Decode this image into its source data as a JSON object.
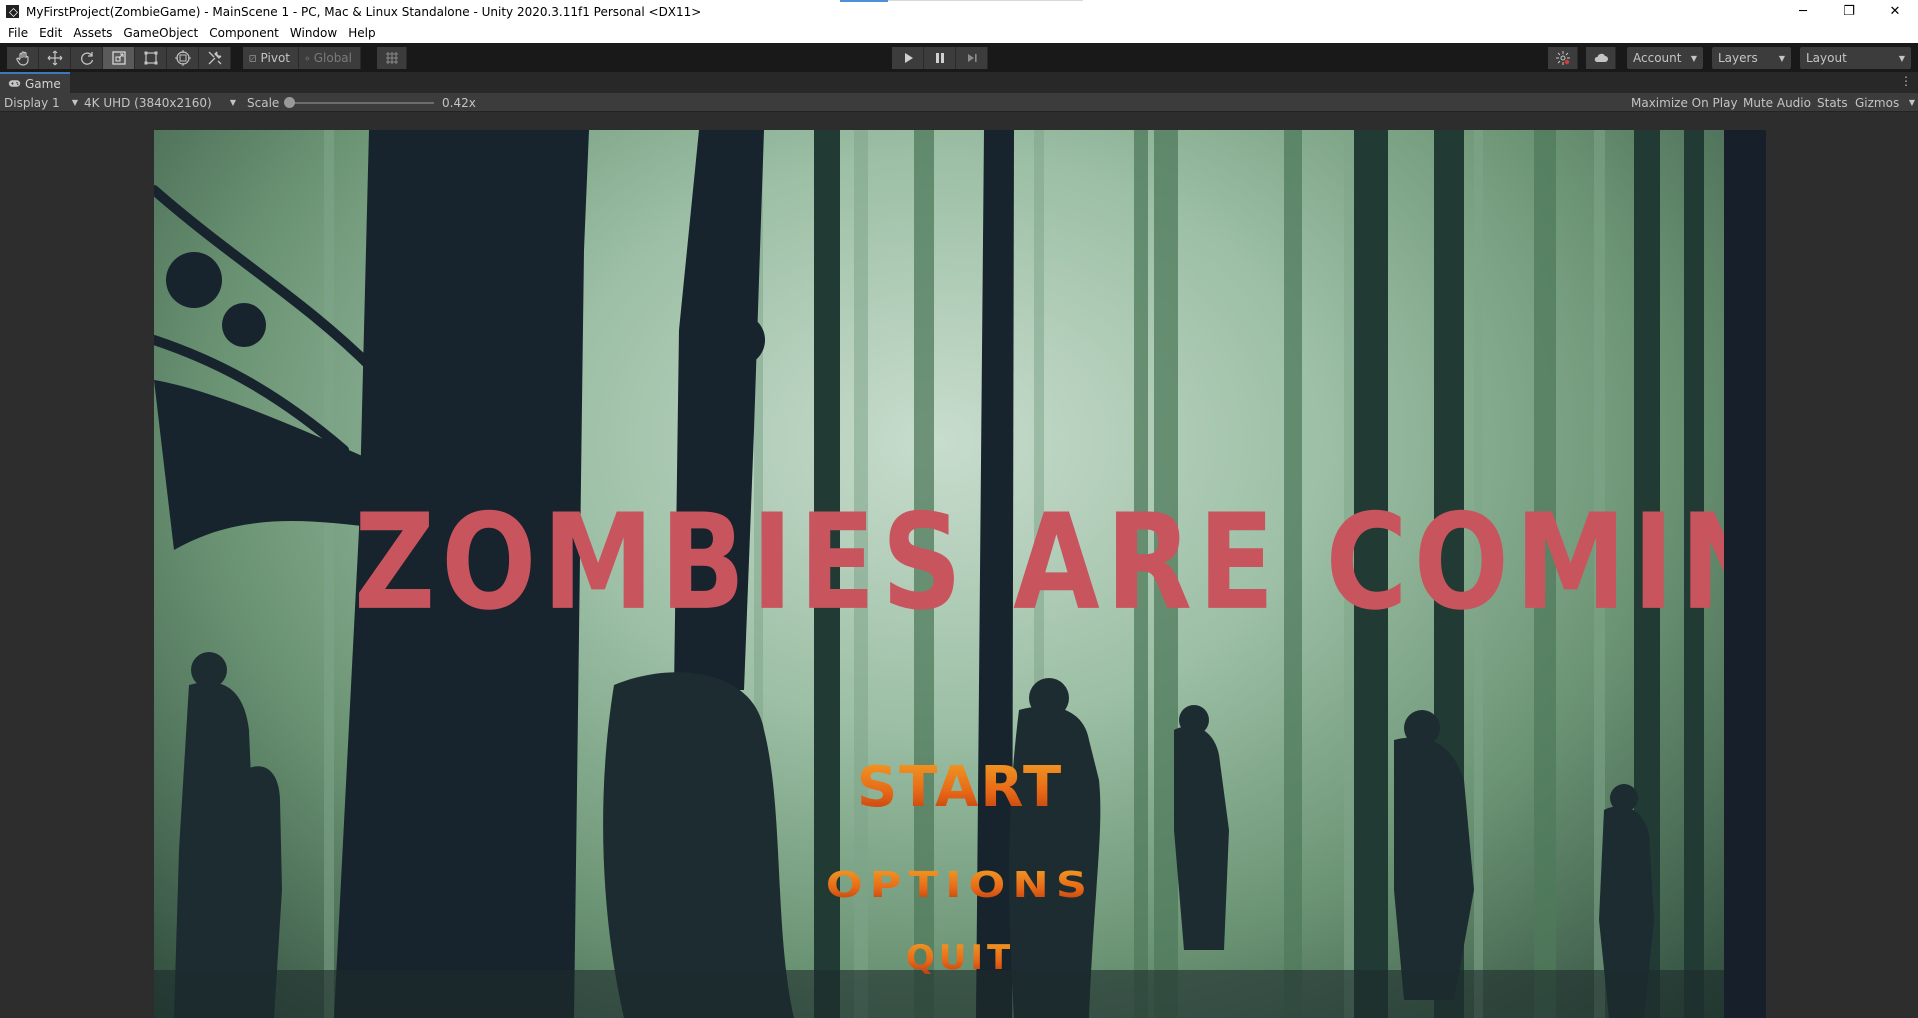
{
  "window": {
    "title": "MyFirstProject(ZombieGame) - MainScene 1 - PC, Mac & Linux Standalone - Unity 2020.3.11f1 Personal <DX11>",
    "minimize": "─",
    "restore": "❐",
    "close": "✕"
  },
  "menu": [
    "File",
    "Edit",
    "Assets",
    "GameObject",
    "Component",
    "Window",
    "Help"
  ],
  "toolbar": {
    "tools": [
      "hand-tool",
      "move-tool",
      "rotate-tool",
      "scale-tool",
      "rect-tool",
      "transform-tool",
      "custom-tool"
    ],
    "active_tool": "scale-tool",
    "pivot_label": "Pivot",
    "global_label": "Global",
    "account_label": "Account",
    "layers_label": "Layers",
    "layout_label": "Layout"
  },
  "tab": {
    "label": "Game",
    "more": "⋮"
  },
  "gamebar": {
    "display_label": "Display 1",
    "resolution_label": "4K UHD (3840x2160)",
    "scale_label": "Scale",
    "scale_value": "0.42x",
    "maximize_label": "Maximize On Play",
    "mute_label": "Mute Audio",
    "stats_label": "Stats",
    "gizmos_label": "Gizmos"
  },
  "game": {
    "title": "ZOMBIES ARE COMING",
    "start": "START",
    "options": "OPTIONS",
    "quit": "QUIT"
  }
}
